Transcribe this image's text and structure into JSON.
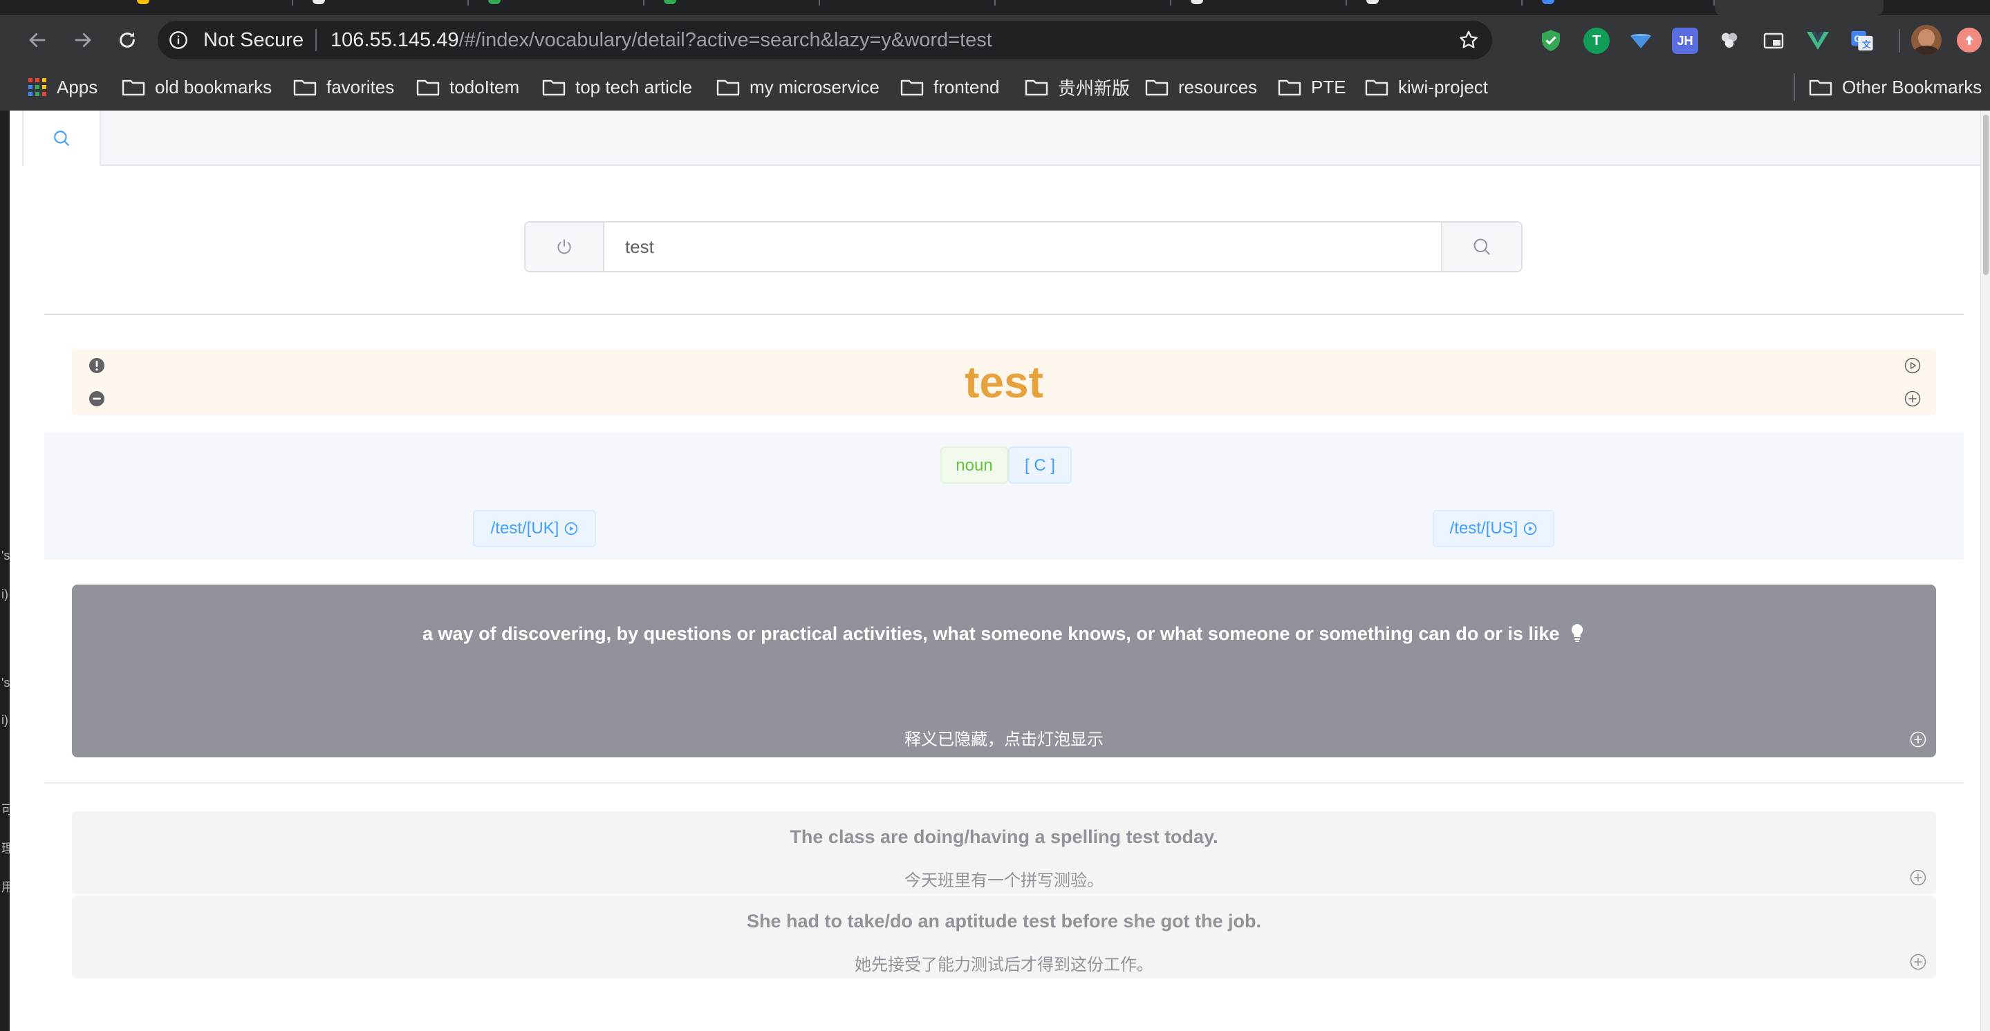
{
  "browser": {
    "omnibox": {
      "security_label": "Not Secure",
      "url_host": "106.55.145.49",
      "url_path": "/#/index/vocabulary/detail?active=search&lazy=y&word=test"
    },
    "bookmarks": [
      {
        "label": "Apps",
        "icon": "apps-grid-icon"
      },
      {
        "label": "old bookmarks",
        "icon": "folder-icon"
      },
      {
        "label": "favorites",
        "icon": "folder-icon"
      },
      {
        "label": "todoItem",
        "icon": "folder-icon"
      },
      {
        "label": "top tech article",
        "icon": "folder-icon"
      },
      {
        "label": "my microservice",
        "icon": "folder-icon"
      },
      {
        "label": "frontend",
        "icon": "folder-icon"
      },
      {
        "label": "贵州新版",
        "icon": "folder-icon"
      },
      {
        "label": "resources",
        "icon": "folder-icon"
      },
      {
        "label": "PTE",
        "icon": "folder-icon"
      },
      {
        "label": "kiwi-project",
        "icon": "folder-icon"
      }
    ],
    "other_bookmarks": "Other Bookmarks",
    "extensions": [
      {
        "name": "shield-extension-icon",
        "color": "#34a853"
      },
      {
        "name": "tampermonkey-extension-icon",
        "label": "T",
        "color": "#0f9d58"
      },
      {
        "name": "feedly-extension-icon",
        "color": "#4a90e2"
      },
      {
        "name": "jh-extension-icon",
        "label": "JH",
        "color": "#5b6ee1"
      },
      {
        "name": "puzzle-extension-icon",
        "color": "#9aa0a6"
      },
      {
        "name": "picture-in-picture-icon",
        "color": "#9aa0a6"
      },
      {
        "name": "vue-devtools-icon",
        "label": "V",
        "color": "#42b883"
      },
      {
        "name": "google-translate-icon",
        "color": "#4285f4"
      }
    ]
  },
  "app": {
    "tabs": [
      {
        "icon": "search-icon"
      }
    ],
    "search": {
      "value": "test"
    },
    "word": "test",
    "tags": {
      "pos": "noun",
      "grammar": "[ C ]"
    },
    "pronunciations": {
      "uk": "/test/[UK]",
      "us": "/test/[US]"
    },
    "definition": {
      "en": "a way of discovering, by questions or practical activities, what someone knows, or what someone or something can do or is like",
      "cn": "释义已隐藏，点击灯泡显示"
    },
    "examples": [
      {
        "en": "The class are doing/having a spelling test today.",
        "cn": "今天班里有一个拼写测验。"
      },
      {
        "en": "She had to take/do an aptitude test before she got the job.",
        "cn": "她先接受了能力测试后才得到这份工作。"
      }
    ],
    "colors": {
      "word": "#e6a23c",
      "word_bg": "#fdf6ec",
      "tag_green": "#67c23a",
      "tag_blue": "#409eff",
      "definition_bg": "#909399"
    }
  },
  "sidebar_fragments": [
    "'s",
    "i)",
    "'s",
    "i)",
    "可",
    "理",
    "用"
  ]
}
